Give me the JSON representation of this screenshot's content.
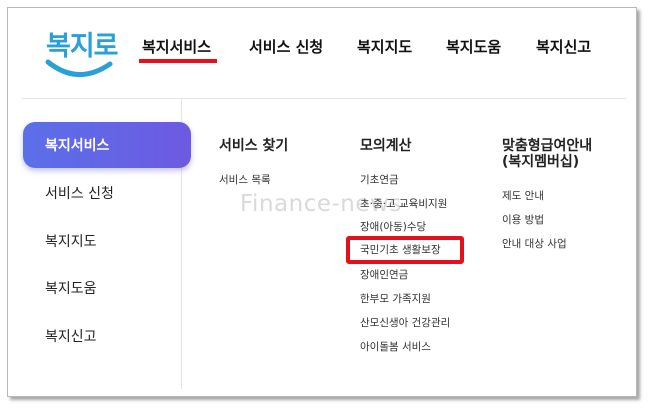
{
  "logo": {
    "text": "복지로"
  },
  "topnav": {
    "items": [
      "복지서비스",
      "서비스 신청",
      "복지지도",
      "복지도움",
      "복지신고"
    ],
    "active_index": 0
  },
  "sidebar": {
    "items": [
      "복지서비스",
      "서비스 신청",
      "복지지도",
      "복지도움",
      "복지신고"
    ],
    "active_index": 0
  },
  "columns": [
    {
      "heading": "서비스 찾기",
      "links": [
        "서비스 목록"
      ]
    },
    {
      "heading": "모의계산",
      "links": [
        "기초연금",
        "초·중·고 교육비지원",
        "장애(아동)수당",
        "국민기초 생활보장",
        "장애인연금",
        "한부모 가족지원",
        "산모신생아 건강관리",
        "아이돌봄 서비스"
      ],
      "highlighted_index": 3
    },
    {
      "heading_lines": [
        "맞춤형급여안내",
        "(복지멤버십)"
      ],
      "links": [
        "제도 안내",
        "이용 방법",
        "안내 대상 사업"
      ]
    }
  ],
  "watermark": "Finance-news",
  "colors": {
    "accent_red": "#e5101b",
    "active_gradient_start": "#5b6fe8",
    "active_gradient_end": "#6d5ae2",
    "logo_blue": "#2aa0d8"
  }
}
